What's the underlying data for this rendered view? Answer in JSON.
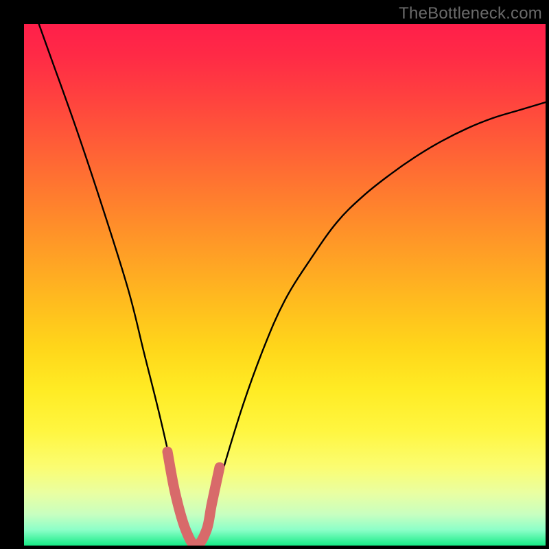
{
  "watermark": "TheBottleneck.com",
  "colors": {
    "background": "#000000",
    "curve_stroke": "#000000",
    "valley_stroke": "#d86a6a",
    "gradient_top": "#ff1f4a",
    "gradient_bottom": "#17eb86"
  },
  "chart_data": {
    "type": "line",
    "title": "",
    "xlabel": "",
    "ylabel": "",
    "xlim": [
      0,
      100
    ],
    "ylim": [
      0,
      100
    ],
    "grid": false,
    "legend": false,
    "series": [
      {
        "name": "bottleneck-curve",
        "x": [
          0,
          5,
          10,
          15,
          20,
          23,
          26,
          29,
          31,
          33,
          35,
          38,
          42,
          46,
          50,
          55,
          60,
          65,
          70,
          75,
          80,
          85,
          90,
          95,
          100
        ],
        "y": [
          108,
          94,
          80,
          65,
          49,
          37,
          25,
          12,
          4,
          0,
          3,
          14,
          27,
          38,
          47,
          55,
          62,
          67,
          71,
          74.5,
          77.5,
          80,
          82,
          83.5,
          85
        ]
      },
      {
        "name": "bottleneck-valley-highlight",
        "x": [
          27.5,
          29,
          31,
          33,
          35,
          36,
          37.5
        ],
        "y": [
          18,
          10,
          3,
          0,
          3,
          8,
          15
        ]
      }
    ],
    "annotations": []
  }
}
